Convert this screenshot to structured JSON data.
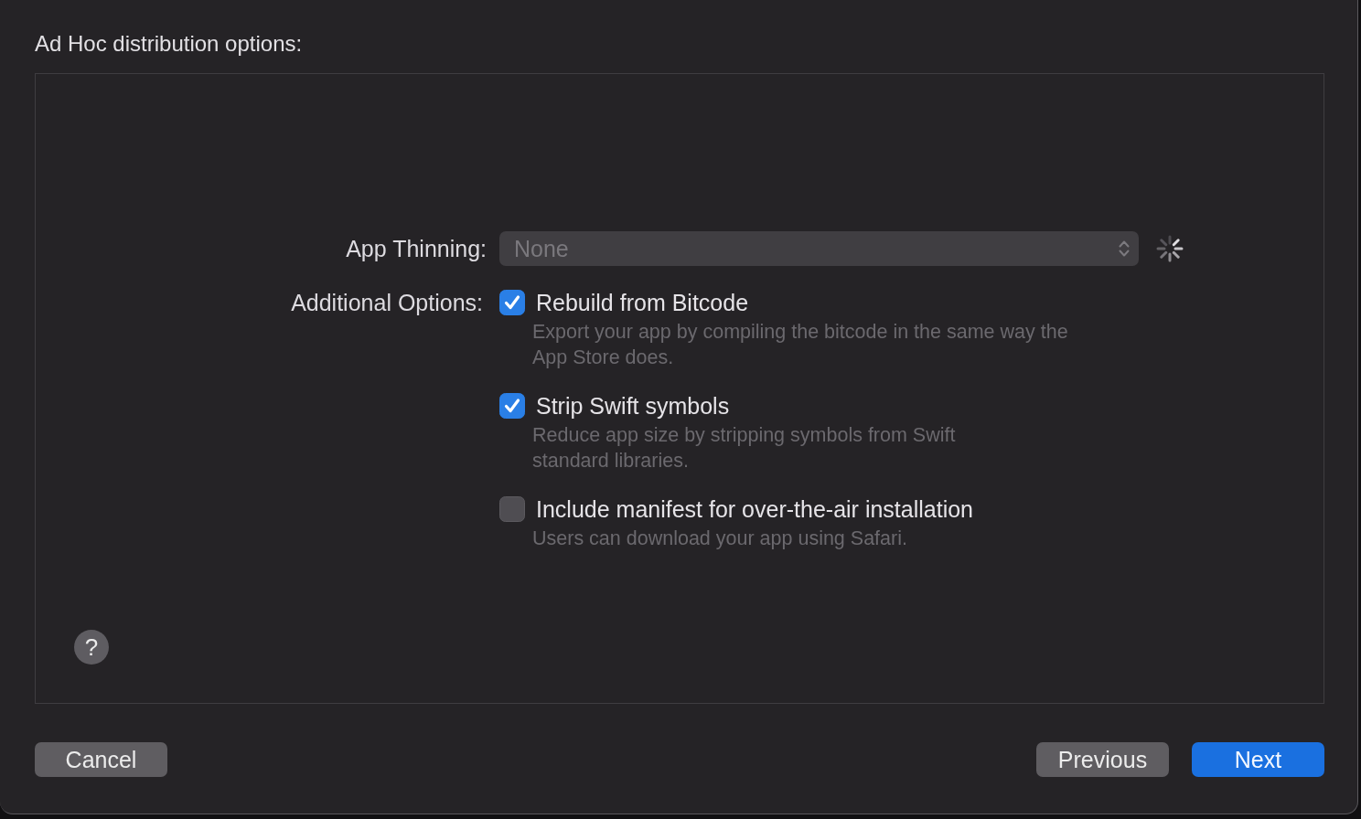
{
  "window": {
    "title": "Ad Hoc distribution options:"
  },
  "app_thinning": {
    "label": "App Thinning:",
    "value": "None",
    "disabled": true,
    "loading": true
  },
  "additional_options": {
    "label": "Additional Options:",
    "options": [
      {
        "label": "Rebuild from Bitcode",
        "checked": true,
        "description": "Export your app by compiling the bitcode in the same way the\nApp Store does."
      },
      {
        "label": "Strip Swift symbols",
        "checked": true,
        "description": "Reduce app size by stripping symbols from Swift\nstandard libraries."
      },
      {
        "label": "Include manifest for over-the-air installation",
        "checked": false,
        "description": "Users can download your app using Safari."
      }
    ]
  },
  "help_button": {
    "label": "?"
  },
  "footer": {
    "left": [
      {
        "label": "Cancel",
        "kind": "secondary"
      }
    ],
    "right": [
      {
        "label": "Previous",
        "kind": "secondary"
      },
      {
        "label": "Next",
        "kind": "primary"
      }
    ]
  }
}
